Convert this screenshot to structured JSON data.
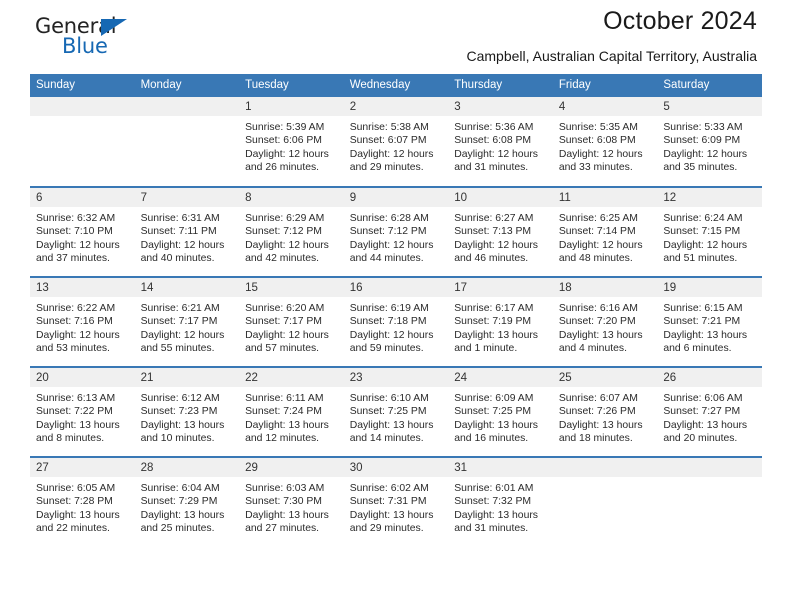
{
  "brand": {
    "name_part1": "General",
    "name_part2": "Blue",
    "triangle_color": "#1668b3",
    "accent_color": "#3978b5"
  },
  "header": {
    "title": "October 2024",
    "subtitle": "Campbell, Australian Capital Territory, Australia"
  },
  "calendar": {
    "weekday_headers": [
      "Sunday",
      "Monday",
      "Tuesday",
      "Wednesday",
      "Thursday",
      "Friday",
      "Saturday"
    ],
    "weeks": [
      [
        {
          "day": "",
          "detail": ""
        },
        {
          "day": "",
          "detail": ""
        },
        {
          "day": "1",
          "detail": "Sunrise: 5:39 AM\nSunset: 6:06 PM\nDaylight: 12 hours and 26 minutes."
        },
        {
          "day": "2",
          "detail": "Sunrise: 5:38 AM\nSunset: 6:07 PM\nDaylight: 12 hours and 29 minutes."
        },
        {
          "day": "3",
          "detail": "Sunrise: 5:36 AM\nSunset: 6:08 PM\nDaylight: 12 hours and 31 minutes."
        },
        {
          "day": "4",
          "detail": "Sunrise: 5:35 AM\nSunset: 6:08 PM\nDaylight: 12 hours and 33 minutes."
        },
        {
          "day": "5",
          "detail": "Sunrise: 5:33 AM\nSunset: 6:09 PM\nDaylight: 12 hours and 35 minutes."
        }
      ],
      [
        {
          "day": "6",
          "detail": "Sunrise: 6:32 AM\nSunset: 7:10 PM\nDaylight: 12 hours and 37 minutes."
        },
        {
          "day": "7",
          "detail": "Sunrise: 6:31 AM\nSunset: 7:11 PM\nDaylight: 12 hours and 40 minutes."
        },
        {
          "day": "8",
          "detail": "Sunrise: 6:29 AM\nSunset: 7:12 PM\nDaylight: 12 hours and 42 minutes."
        },
        {
          "day": "9",
          "detail": "Sunrise: 6:28 AM\nSunset: 7:12 PM\nDaylight: 12 hours and 44 minutes."
        },
        {
          "day": "10",
          "detail": "Sunrise: 6:27 AM\nSunset: 7:13 PM\nDaylight: 12 hours and 46 minutes."
        },
        {
          "day": "11",
          "detail": "Sunrise: 6:25 AM\nSunset: 7:14 PM\nDaylight: 12 hours and 48 minutes."
        },
        {
          "day": "12",
          "detail": "Sunrise: 6:24 AM\nSunset: 7:15 PM\nDaylight: 12 hours and 51 minutes."
        }
      ],
      [
        {
          "day": "13",
          "detail": "Sunrise: 6:22 AM\nSunset: 7:16 PM\nDaylight: 12 hours and 53 minutes."
        },
        {
          "day": "14",
          "detail": "Sunrise: 6:21 AM\nSunset: 7:17 PM\nDaylight: 12 hours and 55 minutes."
        },
        {
          "day": "15",
          "detail": "Sunrise: 6:20 AM\nSunset: 7:17 PM\nDaylight: 12 hours and 57 minutes."
        },
        {
          "day": "16",
          "detail": "Sunrise: 6:19 AM\nSunset: 7:18 PM\nDaylight: 12 hours and 59 minutes."
        },
        {
          "day": "17",
          "detail": "Sunrise: 6:17 AM\nSunset: 7:19 PM\nDaylight: 13 hours and 1 minute."
        },
        {
          "day": "18",
          "detail": "Sunrise: 6:16 AM\nSunset: 7:20 PM\nDaylight: 13 hours and 4 minutes."
        },
        {
          "day": "19",
          "detail": "Sunrise: 6:15 AM\nSunset: 7:21 PM\nDaylight: 13 hours and 6 minutes."
        }
      ],
      [
        {
          "day": "20",
          "detail": "Sunrise: 6:13 AM\nSunset: 7:22 PM\nDaylight: 13 hours and 8 minutes."
        },
        {
          "day": "21",
          "detail": "Sunrise: 6:12 AM\nSunset: 7:23 PM\nDaylight: 13 hours and 10 minutes."
        },
        {
          "day": "22",
          "detail": "Sunrise: 6:11 AM\nSunset: 7:24 PM\nDaylight: 13 hours and 12 minutes."
        },
        {
          "day": "23",
          "detail": "Sunrise: 6:10 AM\nSunset: 7:25 PM\nDaylight: 13 hours and 14 minutes."
        },
        {
          "day": "24",
          "detail": "Sunrise: 6:09 AM\nSunset: 7:25 PM\nDaylight: 13 hours and 16 minutes."
        },
        {
          "day": "25",
          "detail": "Sunrise: 6:07 AM\nSunset: 7:26 PM\nDaylight: 13 hours and 18 minutes."
        },
        {
          "day": "26",
          "detail": "Sunrise: 6:06 AM\nSunset: 7:27 PM\nDaylight: 13 hours and 20 minutes."
        }
      ],
      [
        {
          "day": "27",
          "detail": "Sunrise: 6:05 AM\nSunset: 7:28 PM\nDaylight: 13 hours and 22 minutes."
        },
        {
          "day": "28",
          "detail": "Sunrise: 6:04 AM\nSunset: 7:29 PM\nDaylight: 13 hours and 25 minutes."
        },
        {
          "day": "29",
          "detail": "Sunrise: 6:03 AM\nSunset: 7:30 PM\nDaylight: 13 hours and 27 minutes."
        },
        {
          "day": "30",
          "detail": "Sunrise: 6:02 AM\nSunset: 7:31 PM\nDaylight: 13 hours and 29 minutes."
        },
        {
          "day": "31",
          "detail": "Sunrise: 6:01 AM\nSunset: 7:32 PM\nDaylight: 13 hours and 31 minutes."
        },
        {
          "day": "",
          "detail": ""
        },
        {
          "day": "",
          "detail": ""
        }
      ]
    ]
  }
}
